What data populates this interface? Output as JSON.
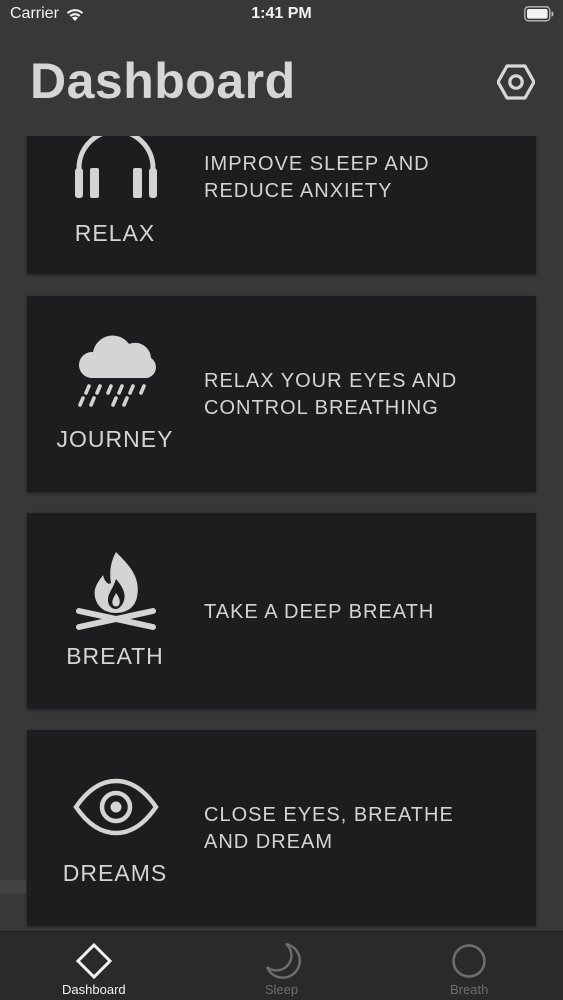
{
  "status_bar": {
    "carrier": "Carrier",
    "time": "1:41 PM"
  },
  "header": {
    "title": "Dashboard",
    "settings_icon": "gear-hexagon-icon"
  },
  "cards": [
    {
      "label": "RELAX",
      "desc_line1": "IMPROVE SLEEP AND",
      "desc_line2": "REDUCE ANXIETY",
      "icon": "headphones-icon"
    },
    {
      "label": "JOURNEY",
      "desc_line1": "RELAX YOUR EYES AND",
      "desc_line2": "CONTROL BREATHING",
      "icon": "rain-cloud-icon"
    },
    {
      "label": "BREATH",
      "desc_line1": "TAKE A DEEP BREATH",
      "desc_line2": "",
      "icon": "campfire-icon"
    },
    {
      "label": "DREAMS",
      "desc_line1": "CLOSE EYES, BREATHE",
      "desc_line2": "AND DREAM",
      "icon": "eye-icon"
    }
  ],
  "tab_bar": {
    "active": "Dashboard",
    "tabs": [
      {
        "label": "Dashboard",
        "icon": "diamond-icon"
      },
      {
        "label": "Sleep",
        "icon": "moon-icon"
      },
      {
        "label": "Breath",
        "icon": "circle-icon"
      }
    ]
  },
  "colors": {
    "background": "#383839",
    "card": "#1d1c1e",
    "text": "#d4d4d4",
    "tab_inactive": "#6e6e6f"
  }
}
